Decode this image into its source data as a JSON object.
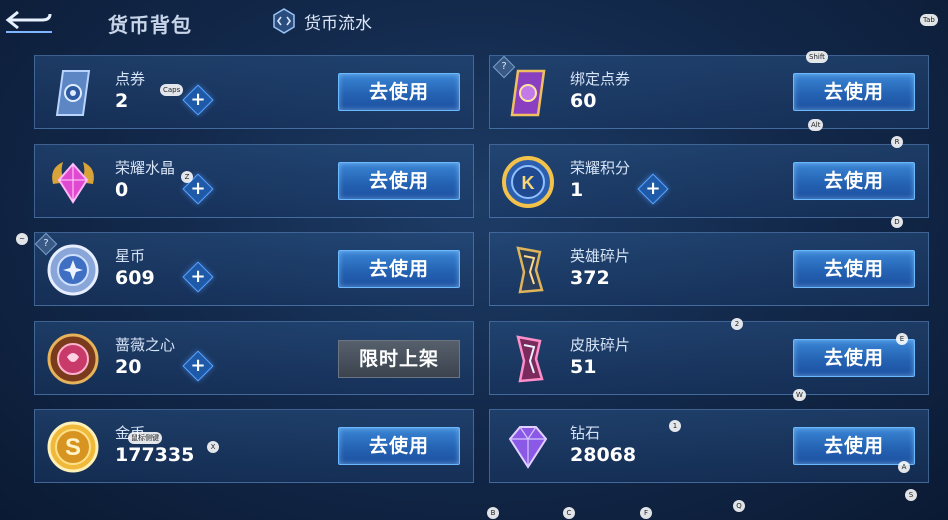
{
  "header": {
    "title": "货币背包",
    "flow_tab_label": "货币流水"
  },
  "colors": {
    "button_blue": "#2a6cc0",
    "limited_gray": "#4a525d"
  },
  "left_cards": [
    {
      "name": "点券",
      "value": "2",
      "has_plus": true,
      "button": "去使用",
      "icon": "ticket-icon"
    },
    {
      "name": "荣耀水晶",
      "value": "0",
      "has_plus": true,
      "button": "去使用",
      "icon": "crystal-icon"
    },
    {
      "name": "星币",
      "value": "609",
      "has_plus": true,
      "button": "去使用",
      "icon": "star-coin-icon"
    },
    {
      "name": "蔷薇之心",
      "value": "20",
      "has_plus": true,
      "button": "限时上架",
      "icon": "rose-heart-icon"
    },
    {
      "name": "金币",
      "value": "177335",
      "has_plus": false,
      "button": "去使用",
      "icon": "gold-coin-icon"
    }
  ],
  "right_cards": [
    {
      "name": "绑定点券",
      "value": "60",
      "has_plus": false,
      "button": "去使用",
      "icon": "bound-ticket-icon"
    },
    {
      "name": "荣耀积分",
      "value": "1",
      "has_plus": true,
      "button": "去使用",
      "icon": "honor-points-icon"
    },
    {
      "name": "英雄碎片",
      "value": "372",
      "has_plus": false,
      "button": "去使用",
      "icon": "hero-shard-icon"
    },
    {
      "name": "皮肤碎片",
      "value": "51",
      "has_plus": false,
      "button": "去使用",
      "icon": "skin-shard-icon"
    },
    {
      "name": "钻石",
      "value": "28068",
      "has_plus": false,
      "button": "去使用",
      "icon": "diamond-icon"
    }
  ],
  "key_hints": [
    "Tab",
    "Shift",
    "Alt",
    "Caps",
    "R",
    "Z",
    "D",
    "~",
    "2",
    "E",
    "W",
    "鼠标侧键",
    "X",
    "1",
    "A",
    "S",
    "Q",
    "B",
    "C",
    "F",
    "?"
  ]
}
